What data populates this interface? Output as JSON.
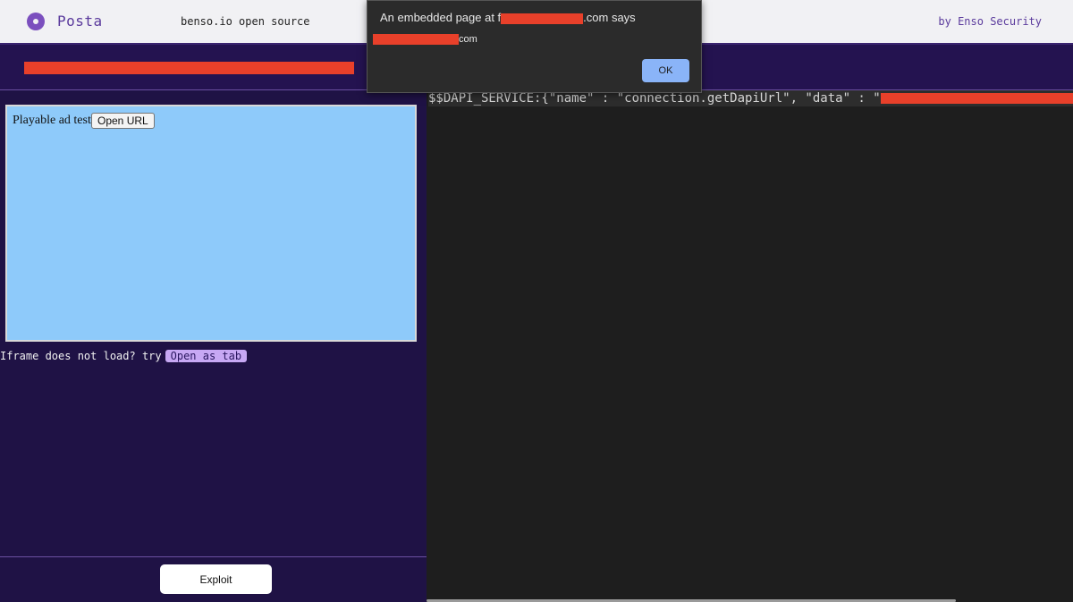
{
  "header": {
    "app_name": "Posta",
    "tagline": "benso.io open source",
    "byline": "by Enso Security"
  },
  "preview": {
    "iframe_text": "Playable ad test",
    "open_url_label": "Open URL",
    "fallback_text": "Iframe does not load? try",
    "open_tab_label": "Open as tab",
    "exploit_label": "Exploit"
  },
  "log": {
    "line_text": "$$DAPI_SERVICE:{\"name\" : \"connection.getDapiUrl\", \"data\" : \""
  },
  "dialog": {
    "title_prefix": "An embedded page at f",
    "title_suffix": ".com says",
    "message_suffix": "com",
    "ok_label": "OK"
  },
  "colors": {
    "brand_purple": "#5a3a9c",
    "page_background": "#1f1245",
    "redaction": "#e8402a"
  }
}
